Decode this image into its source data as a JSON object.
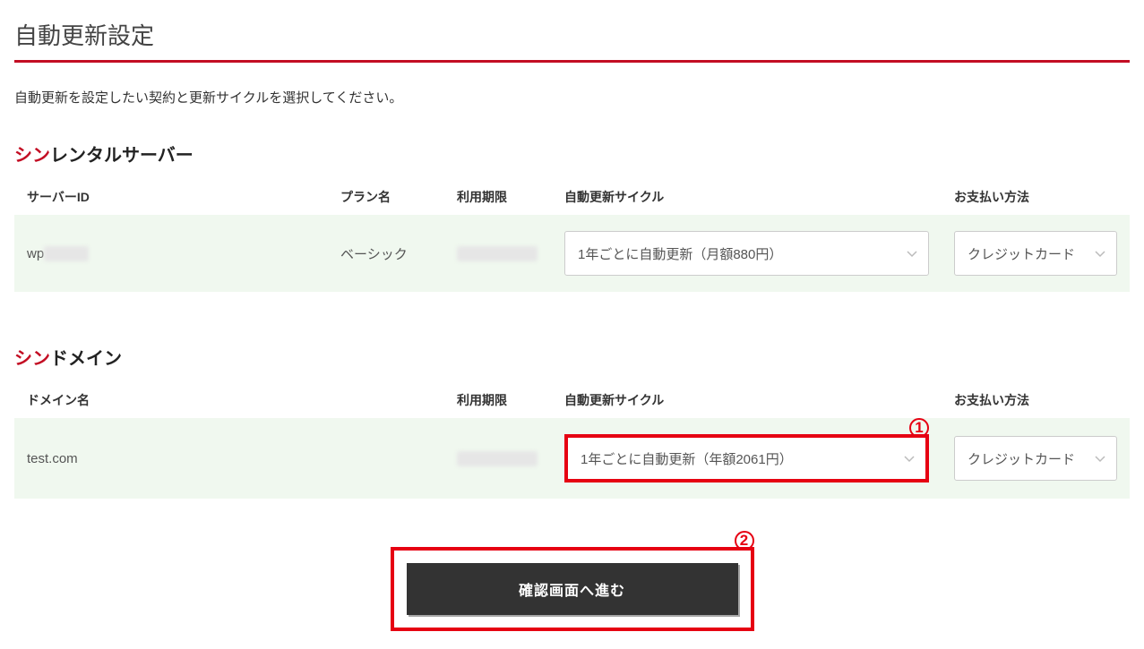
{
  "page": {
    "title": "自動更新設定",
    "description": "自動更新を設定したい契約と更新サイクルを選択してください。"
  },
  "sections": {
    "server": {
      "brand_prefix": "シン",
      "heading_rest": "レンタルサーバー",
      "headers": {
        "id": "サーバーID",
        "plan": "プラン名",
        "expire": "利用期限",
        "cycle": "自動更新サイクル",
        "payment": "お支払い方法"
      },
      "row": {
        "id_prefix": "wp",
        "id_masked": "XXXXX",
        "plan": "ベーシック",
        "expire_masked": "XXXXXXXXX",
        "cycle_selected": "1年ごとに自動更新（月額880円）",
        "payment_selected": "クレジットカード"
      }
    },
    "domain": {
      "brand_prefix": "シン",
      "heading_rest": "ドメイン",
      "headers": {
        "name": "ドメイン名",
        "expire": "利用期限",
        "cycle": "自動更新サイクル",
        "payment": "お支払い方法"
      },
      "row": {
        "name": "test.com",
        "expire_masked": "XXXXXXXXX",
        "cycle_selected": "1年ごとに自動更新（年額2061円）",
        "payment_selected": "クレジットカード"
      }
    }
  },
  "callouts": {
    "one": "1",
    "two": "2"
  },
  "actions": {
    "confirm_label": "確認画面へ進む"
  }
}
